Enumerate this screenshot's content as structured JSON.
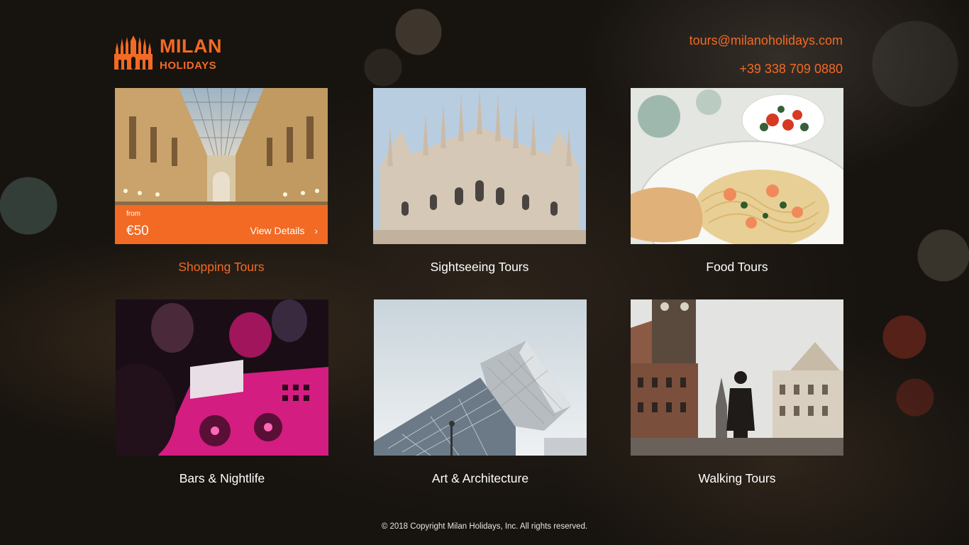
{
  "brand": {
    "name": "MILAN",
    "tagline": "HOLIDAYS",
    "accent_color": "#f26a24"
  },
  "contact": {
    "email": "tours@milanoholidays.com",
    "phone": "+39 338 709 0880"
  },
  "tours": [
    {
      "label": "Shopping Tours",
      "image_icon": "galleria-arcade-photo",
      "active": true,
      "price_from_label": "from",
      "price": "€50",
      "details_label": "View Details"
    },
    {
      "label": "Sightseeing Tours",
      "image_icon": "cathedral-photo"
    },
    {
      "label": "Food Tours",
      "image_icon": "pasta-dish-photo"
    },
    {
      "label": "Bars & Nightlife",
      "image_icon": "dj-mixer-photo"
    },
    {
      "label": "Art & Architecture",
      "image_icon": "modern-building-photo"
    },
    {
      "label": "Walking Tours",
      "image_icon": "old-town-street-photo"
    }
  ],
  "footer": {
    "copyright": "© 2018 Copyright Milan Holidays, Inc. All rights reserved."
  }
}
